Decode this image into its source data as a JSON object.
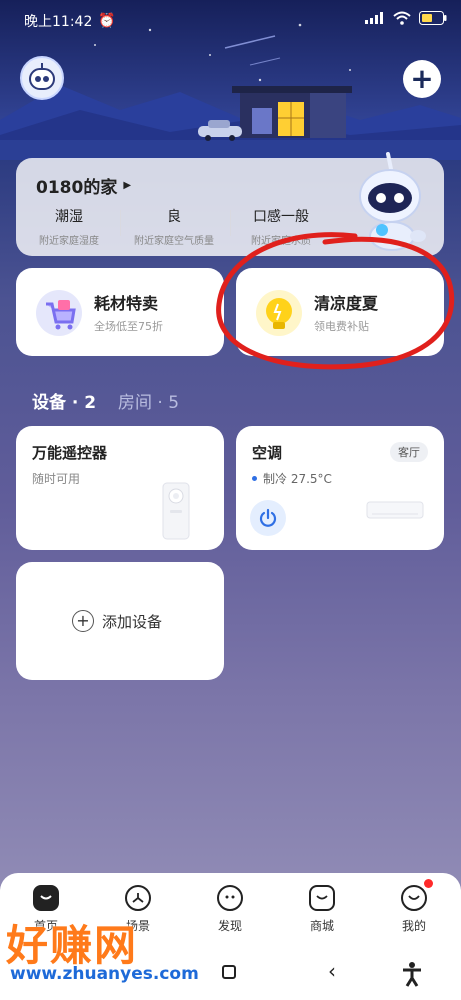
{
  "status_bar": {
    "time": "晚上11:42"
  },
  "home": {
    "title": "0180的家",
    "stats": [
      {
        "value": "潮湿",
        "label": "附近家庭湿度"
      },
      {
        "value": "良",
        "label": "附近家庭空气质量"
      },
      {
        "value": "口感一般",
        "label": "附近家庭水质"
      }
    ]
  },
  "promos": [
    {
      "title": "耗材特卖",
      "subtitle": "全场低至75折"
    },
    {
      "title": "清凉度夏",
      "subtitle": "领电费补贴"
    }
  ],
  "tabs": [
    {
      "label": "设备 · 2"
    },
    {
      "label": "房间 · 5"
    }
  ],
  "devices": [
    {
      "name": "万能遥控器",
      "status": "随时可用"
    },
    {
      "name": "空调",
      "room": "客厅",
      "status": "制冷 27.5°C"
    }
  ],
  "add_device": {
    "label": "添加设备"
  },
  "bottom_nav": [
    {
      "label": "首页"
    },
    {
      "label": "场景"
    },
    {
      "label": "发现"
    },
    {
      "label": "商城"
    },
    {
      "label": "我的"
    }
  ],
  "watermark": {
    "text": "好赚网",
    "url": "www.zhuanyes.com"
  },
  "colors": {
    "accent": "#2f6fe4",
    "annotation": "#e0201c"
  }
}
